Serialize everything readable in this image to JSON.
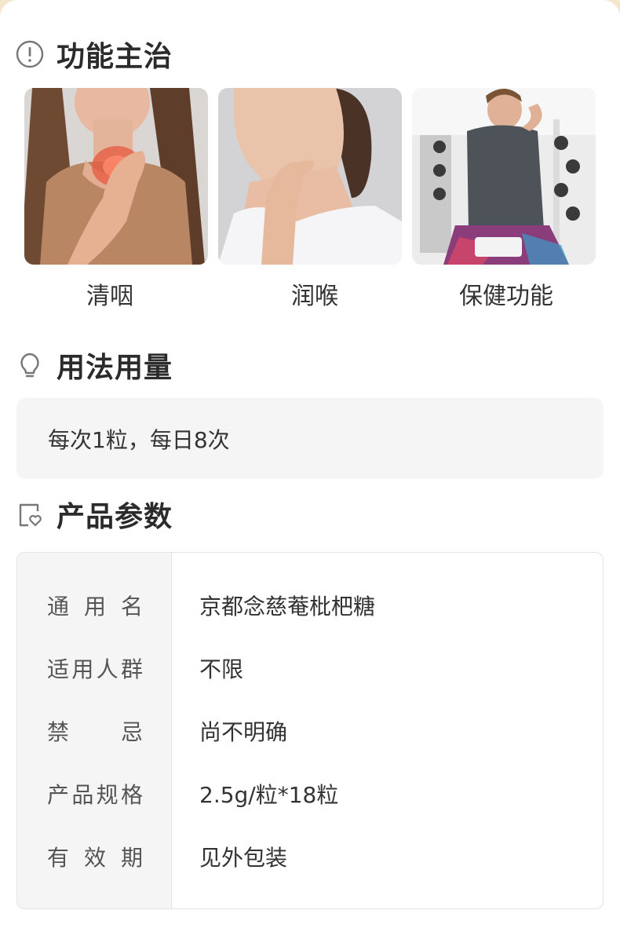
{
  "sections": {
    "function": {
      "title": "功能主治",
      "icon": "info-circle-icon"
    },
    "usage": {
      "title": "用法用量",
      "icon": "lightbulb-icon",
      "text": "每次1粒，每日8次"
    },
    "params": {
      "title": "产品参数",
      "icon": "document-heart-icon"
    }
  },
  "functions": [
    {
      "caption": "清咽",
      "image": "woman-throat-pain-photo"
    },
    {
      "caption": "润喉",
      "image": "woman-touching-neck-photo"
    },
    {
      "caption": "保健功能",
      "image": "woman-tired-at-gym-photo"
    }
  ],
  "params": [
    {
      "label": "通用名",
      "value": "京都念慈菴枇杷糖"
    },
    {
      "label": "适用人群",
      "value": "不限"
    },
    {
      "label": "禁忌",
      "value": "尚不明确"
    },
    {
      "label": "产品规格",
      "value": "2.5g/粒*18粒"
    },
    {
      "label": "有效期",
      "value": "见外包装"
    }
  ],
  "colors": {
    "page_bg": "#f6e6cc",
    "card_bg": "#ffffff",
    "panel_bg": "#f5f5f5",
    "text": "#333333",
    "icon": "#777777"
  }
}
